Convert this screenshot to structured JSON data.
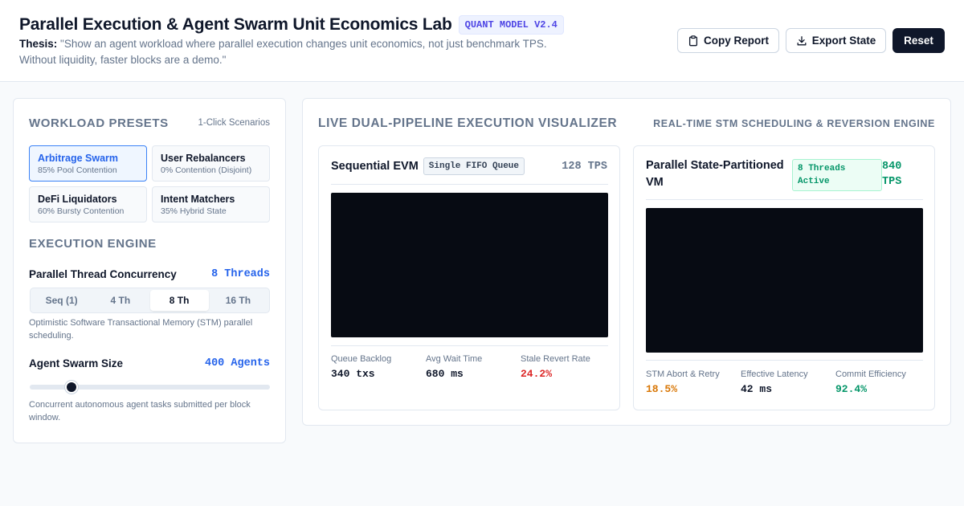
{
  "header": {
    "title": "Parallel Execution & Agent Swarm Unit Economics Lab",
    "version_badge": "QUANT MODEL V2.4",
    "thesis_label": "Thesis:",
    "thesis_text": "\"Show an agent workload where parallel execution changes unit economics, not just benchmark TPS. Without liquidity, faster blocks are a demo.\"",
    "buttons": {
      "copy_report": "Copy Report",
      "export_state": "Export State",
      "reset": "Reset"
    }
  },
  "sidebar": {
    "presets_title": "WORKLOAD PRESETS",
    "presets_hint": "1-Click Scenarios",
    "presets": [
      {
        "name": "Arbitrage Swarm",
        "desc": "85% Pool Contention",
        "active": true
      },
      {
        "name": "User Rebalancers",
        "desc": "0% Contention (Disjoint)",
        "active": false
      },
      {
        "name": "DeFi Liquidators",
        "desc": "60% Bursty Contention",
        "active": false
      },
      {
        "name": "Intent Matchers",
        "desc": "35% Hybrid State",
        "active": false
      }
    ],
    "engine_title": "EXECUTION ENGINE",
    "concurrency_label": "Parallel Thread Concurrency",
    "concurrency_value": "8 Threads",
    "thread_options": [
      {
        "label": "Seq (1)",
        "active": false
      },
      {
        "label": "4 Th",
        "active": false
      },
      {
        "label": "8 Th",
        "active": true
      },
      {
        "label": "16 Th",
        "active": false
      }
    ],
    "concurrency_help": "Optimistic Software Transactional Memory (STM) parallel scheduling.",
    "swarm_label": "Agent Swarm Size",
    "swarm_value": "400 Agents",
    "swarm_slider_fraction": 0.175,
    "swarm_help": "Concurrent autonomous agent tasks submitted per block window."
  },
  "visualizer": {
    "title": "LIVE DUAL-PIPELINE EXECUTION VISUALIZER",
    "subtitle": "REAL-TIME STM SCHEDULING & REVERSION ENGINE",
    "sequential": {
      "title": "Sequential EVM",
      "badge": "Single FIFO Queue",
      "tps": "128 TPS",
      "metrics": [
        {
          "label": "Queue Backlog",
          "value": "340 txs",
          "color": "#0f172a"
        },
        {
          "label": "Avg Wait Time",
          "value": "680 ms",
          "color": "#0f172a"
        },
        {
          "label": "Stale Revert Rate",
          "value": "24.2%",
          "color": "#dc2626"
        }
      ]
    },
    "parallel": {
      "title": "Parallel State-Partitioned VM",
      "badge": "8 Threads Active",
      "tps": "840 TPS",
      "metrics": [
        {
          "label": "STM Abort & Retry",
          "value": "18.5%",
          "color": "#d97706"
        },
        {
          "label": "Effective Latency",
          "value": "42 ms",
          "color": "#0f172a"
        },
        {
          "label": "Commit Efficiency",
          "value": "92.4%",
          "color": "#059669"
        }
      ]
    }
  }
}
